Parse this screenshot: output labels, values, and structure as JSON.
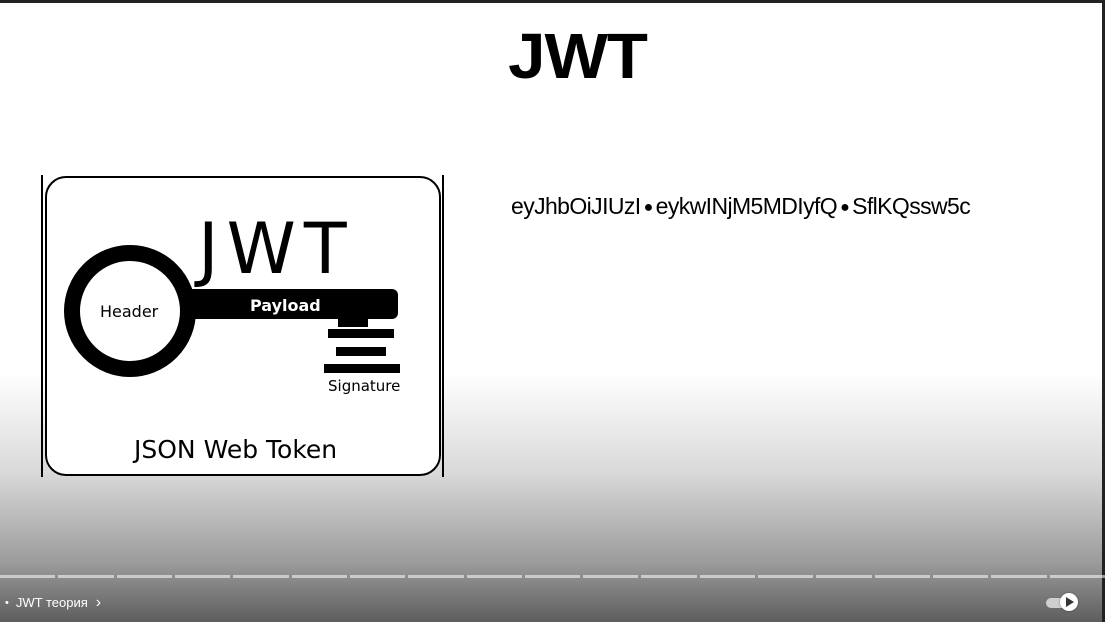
{
  "slide": {
    "title": "JWT",
    "token": {
      "part1": "eyJhbOiJIUzI",
      "part2": "eykwINjM5MDIyfQ",
      "part3": "SflKQssw5c",
      "separator": "●"
    }
  },
  "logo": {
    "big_text": "JWT",
    "header_label": "Header",
    "payload_label": "Payload",
    "signature_label": "Signature",
    "caption": "JSON Web Token"
  },
  "player": {
    "chapter_bullet": "•",
    "chapter_title": "JWT теория",
    "chapter_chevron": "›",
    "autoplay_icon": "play-icon",
    "progress_segments": 19
  }
}
